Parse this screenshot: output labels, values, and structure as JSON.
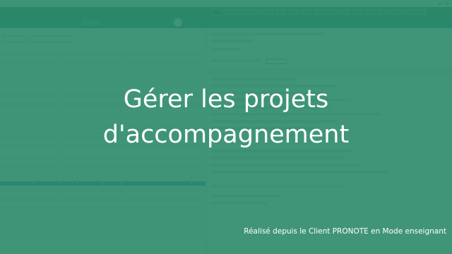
{
  "title_line1": "Gérer les projets",
  "title_line2": "d'accompagnement",
  "caption": "Réalisé depuis le Client PRONOTE en Mode enseignant",
  "colors": {
    "overlay": "#2b8a6a",
    "navbar": "#1f7a63",
    "text": "#ffffff"
  }
}
